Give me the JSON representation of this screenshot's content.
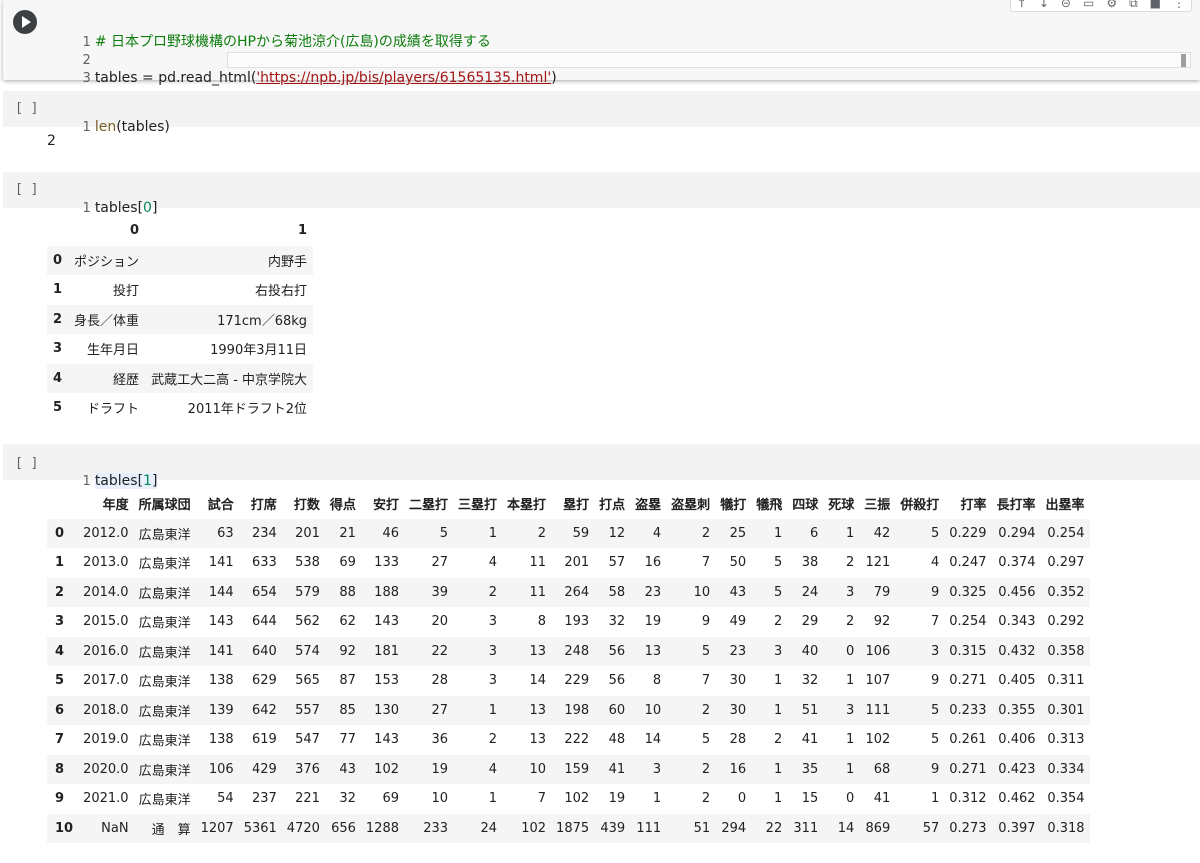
{
  "cell1": {
    "line_numbers": [
      "1",
      "2",
      "3"
    ],
    "line1_comment": "# 日本プロ野球機構のHPから菊池涼介(広島)の成績を取得する",
    "line3_prefix": "tables = pd.read_html(",
    "line3_string": "'https://npb.jp/bis/players/61565135.html'",
    "line3_suffix": ")",
    "toolbar": [
      "↑",
      "↓",
      "⊝",
      "▭",
      "⚙",
      "⧉",
      "■",
      "⋮"
    ]
  },
  "cell2": {
    "exec_count": "[ ]",
    "line_number": "1",
    "fn": "len",
    "arg": "(tables)",
    "output": "2"
  },
  "cell3": {
    "exec_count": "[ ]",
    "line_number": "1",
    "code_prefix": "tables[",
    "code_index": "0",
    "code_suffix": "]"
  },
  "table0": {
    "columns": [
      "0",
      "1"
    ],
    "rows": [
      {
        "index": "0",
        "cells": [
          "ポジション",
          "内野手"
        ]
      },
      {
        "index": "1",
        "cells": [
          "投打",
          "右投右打"
        ]
      },
      {
        "index": "2",
        "cells": [
          "身長／体重",
          "171cm／68kg"
        ]
      },
      {
        "index": "3",
        "cells": [
          "生年月日",
          "1990年3月11日"
        ]
      },
      {
        "index": "4",
        "cells": [
          "経歴",
          "武蔵工大二高 - 中京学院大"
        ]
      },
      {
        "index": "5",
        "cells": [
          "ドラフト",
          "2011年ドラフト2位"
        ]
      }
    ]
  },
  "cell4": {
    "exec_count": "[ ]",
    "line_number": "1",
    "code_prefix": "tables[",
    "code_index": "1",
    "code_suffix": "]"
  },
  "table1": {
    "columns": [
      "年度",
      "所属球団",
      "試合",
      "打席",
      "打数",
      "得点",
      "安打",
      "二塁打",
      "三塁打",
      "本塁打",
      "塁打",
      "打点",
      "盗塁",
      "盗塁刺",
      "犠打",
      "犠飛",
      "四球",
      "死球",
      "三振",
      "併殺打",
      "打率",
      "長打率",
      "出塁率"
    ],
    "rows": [
      {
        "index": "0",
        "cells": [
          "2012.0",
          "広島東洋",
          "63",
          "234",
          "201",
          "21",
          "46",
          "5",
          "1",
          "2",
          "59",
          "12",
          "4",
          "2",
          "25",
          "1",
          "6",
          "1",
          "42",
          "5",
          "0.229",
          "0.294",
          "0.254"
        ]
      },
      {
        "index": "1",
        "cells": [
          "2013.0",
          "広島東洋",
          "141",
          "633",
          "538",
          "69",
          "133",
          "27",
          "4",
          "11",
          "201",
          "57",
          "16",
          "7",
          "50",
          "5",
          "38",
          "2",
          "121",
          "4",
          "0.247",
          "0.374",
          "0.297"
        ]
      },
      {
        "index": "2",
        "cells": [
          "2014.0",
          "広島東洋",
          "144",
          "654",
          "579",
          "88",
          "188",
          "39",
          "2",
          "11",
          "264",
          "58",
          "23",
          "10",
          "43",
          "5",
          "24",
          "3",
          "79",
          "9",
          "0.325",
          "0.456",
          "0.352"
        ]
      },
      {
        "index": "3",
        "cells": [
          "2015.0",
          "広島東洋",
          "143",
          "644",
          "562",
          "62",
          "143",
          "20",
          "3",
          "8",
          "193",
          "32",
          "19",
          "9",
          "49",
          "2",
          "29",
          "2",
          "92",
          "7",
          "0.254",
          "0.343",
          "0.292"
        ]
      },
      {
        "index": "4",
        "cells": [
          "2016.0",
          "広島東洋",
          "141",
          "640",
          "574",
          "92",
          "181",
          "22",
          "3",
          "13",
          "248",
          "56",
          "13",
          "5",
          "23",
          "3",
          "40",
          "0",
          "106",
          "3",
          "0.315",
          "0.432",
          "0.358"
        ]
      },
      {
        "index": "5",
        "cells": [
          "2017.0",
          "広島東洋",
          "138",
          "629",
          "565",
          "87",
          "153",
          "28",
          "3",
          "14",
          "229",
          "56",
          "8",
          "7",
          "30",
          "1",
          "32",
          "1",
          "107",
          "9",
          "0.271",
          "0.405",
          "0.311"
        ]
      },
      {
        "index": "6",
        "cells": [
          "2018.0",
          "広島東洋",
          "139",
          "642",
          "557",
          "85",
          "130",
          "27",
          "1",
          "13",
          "198",
          "60",
          "10",
          "2",
          "30",
          "1",
          "51",
          "3",
          "111",
          "5",
          "0.233",
          "0.355",
          "0.301"
        ]
      },
      {
        "index": "7",
        "cells": [
          "2019.0",
          "広島東洋",
          "138",
          "619",
          "547",
          "77",
          "143",
          "36",
          "2",
          "13",
          "222",
          "48",
          "14",
          "5",
          "28",
          "2",
          "41",
          "1",
          "102",
          "5",
          "0.261",
          "0.406",
          "0.313"
        ]
      },
      {
        "index": "8",
        "cells": [
          "2020.0",
          "広島東洋",
          "106",
          "429",
          "376",
          "43",
          "102",
          "19",
          "4",
          "10",
          "159",
          "41",
          "3",
          "2",
          "16",
          "1",
          "35",
          "1",
          "68",
          "9",
          "0.271",
          "0.423",
          "0.334"
        ]
      },
      {
        "index": "9",
        "cells": [
          "2021.0",
          "広島東洋",
          "54",
          "237",
          "221",
          "32",
          "69",
          "10",
          "1",
          "7",
          "102",
          "19",
          "1",
          "2",
          "0",
          "1",
          "15",
          "0",
          "41",
          "1",
          "0.312",
          "0.462",
          "0.354"
        ]
      },
      {
        "index": "10",
        "cells": [
          "NaN",
          "通　算",
          "1207",
          "5361",
          "4720",
          "656",
          "1288",
          "233",
          "24",
          "102",
          "1875",
          "439",
          "111",
          "51",
          "294",
          "22",
          "311",
          "14",
          "869",
          "57",
          "0.273",
          "0.397",
          "0.318"
        ]
      }
    ]
  }
}
